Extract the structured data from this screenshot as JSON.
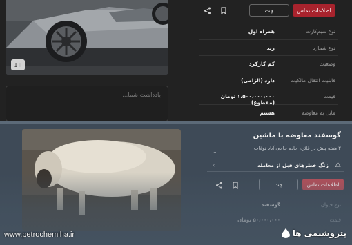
{
  "top_listing": {
    "contact_label": "اطلاعات تماس",
    "chat_label": "چت",
    "note_placeholder": "یادداشت شما...",
    "gallery_badge": "1",
    "details": [
      {
        "label": "نوع سیم‌کارت",
        "value": "همراه اول"
      },
      {
        "label": "نوع شماره",
        "value": "رند"
      },
      {
        "label": "وضعیت",
        "value": "کم کارکرد"
      },
      {
        "label": "قابلیت انتقال مالکیت",
        "value": "دارد (الزامی)"
      },
      {
        "label": "قیمت",
        "value": "۱،۵۰۰،۰۰۰،۰۰۰ تومان (مقطوع)"
      },
      {
        "label": "مایل به معاوضه",
        "value": "هستم"
      }
    ]
  },
  "bottom_listing": {
    "title": "گوسفند معاوضه با ماشین",
    "subtitle": "۲ هفته پیش در قائن، جاده حاجی آباد نوغاب",
    "warning": "زنگ خطرهای قبل از معامله",
    "contact_label": "اطلاعات تماس",
    "chat_label": "چت",
    "details": [
      {
        "label": "نوع حیوان",
        "value": "گوسفند"
      },
      {
        "label": "قیمت",
        "value": "۵۰،۰۰۰،۰۰۰ تومان"
      }
    ]
  },
  "watermark": {
    "url": "www.petrochemiha.ir",
    "brand": "پتروشیمی ها"
  }
}
